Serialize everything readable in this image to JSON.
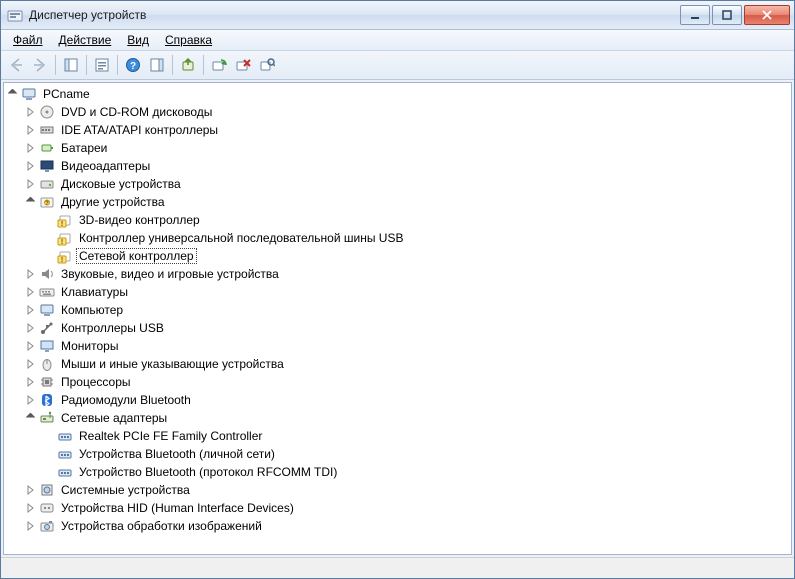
{
  "title": "Диспетчер устройств",
  "menu": {
    "file": "Файл",
    "action": "Действие",
    "view": "Вид",
    "help": "Справка"
  },
  "tree": {
    "root": "PCname",
    "dvd": "DVD и CD-ROM дисководы",
    "ide": "IDE ATA/ATAPI контроллеры",
    "bat": "Батареи",
    "vid": "Видеоадаптеры",
    "disk": "Дисковые устройства",
    "other": "Другие устройства",
    "other_3d": "3D-видео контроллер",
    "other_usb": "Контроллер универсальной последовательной шины USB",
    "other_net": "Сетевой контроллер",
    "sound": "Звуковые, видео и игровые устройства",
    "kbd": "Клавиатуры",
    "computer": "Компьютер",
    "usb": "Контроллеры USB",
    "mon": "Мониторы",
    "mouse": "Мыши и иные указывающие устройства",
    "cpu": "Процессоры",
    "bt": "Радиомодули Bluetooth",
    "net": "Сетевые адаптеры",
    "net_realtek": "Realtek PCIe FE Family Controller",
    "net_btpan": "Устройства Bluetooth (личной сети)",
    "net_btrf": "Устройство Bluetooth (протокол RFCOMM TDI)",
    "sys": "Системные устройства",
    "hid": "Устройства HID (Human Interface Devices)",
    "img": "Устройства обработки изображений"
  }
}
